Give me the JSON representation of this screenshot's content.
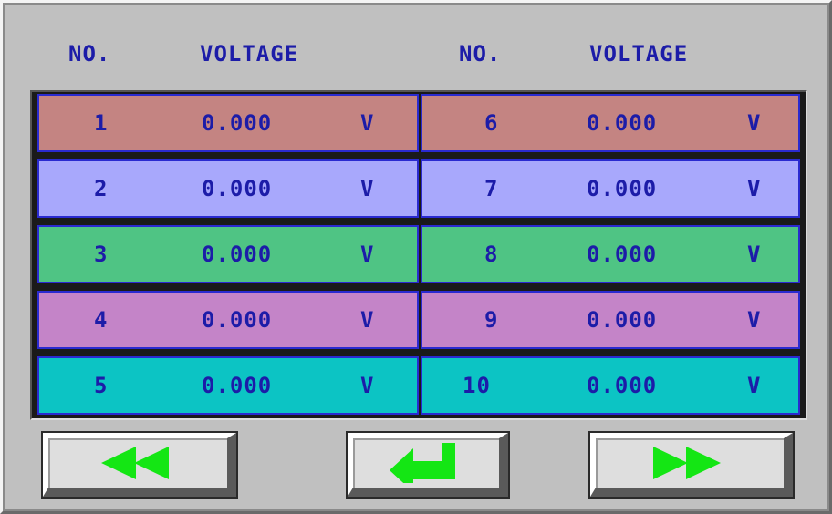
{
  "headers": {
    "no_left": "NO.",
    "voltage_left": "VOLTAGE",
    "no_right": "NO.",
    "voltage_right": "VOLTAGE"
  },
  "rows": [
    {
      "color": "#c48482",
      "left": {
        "no": "1",
        "voltage": "0.000",
        "unit": "V"
      },
      "right": {
        "no": "6",
        "voltage": "0.000",
        "unit": "V"
      }
    },
    {
      "color": "#a8a8fc",
      "left": {
        "no": "2",
        "voltage": "0.000",
        "unit": "V"
      },
      "right": {
        "no": "7",
        "voltage": "0.000",
        "unit": "V"
      }
    },
    {
      "color": "#4fc484",
      "left": {
        "no": "3",
        "voltage": "0.000",
        "unit": "V"
      },
      "right": {
        "no": "8",
        "voltage": "0.000",
        "unit": "V"
      }
    },
    {
      "color": "#c484c8",
      "left": {
        "no": "4",
        "voltage": "0.000",
        "unit": "V"
      },
      "right": {
        "no": "9",
        "voltage": "0.000",
        "unit": "V"
      }
    },
    {
      "color": "#0cc4c4",
      "left": {
        "no": "5",
        "voltage": "0.000",
        "unit": "V"
      },
      "right": {
        "no": "10",
        "voltage": "0.000",
        "unit": "V"
      }
    }
  ],
  "buttons": {
    "previous_icon": "double-arrow-left-icon",
    "enter_icon": "return-arrow-icon",
    "next_icon": "double-arrow-right-icon",
    "icon_color": "#14e614"
  },
  "colors": {
    "text": "#1c1ca8",
    "cell_border": "#2a2ad0",
    "panel": "#c0c0c0"
  }
}
